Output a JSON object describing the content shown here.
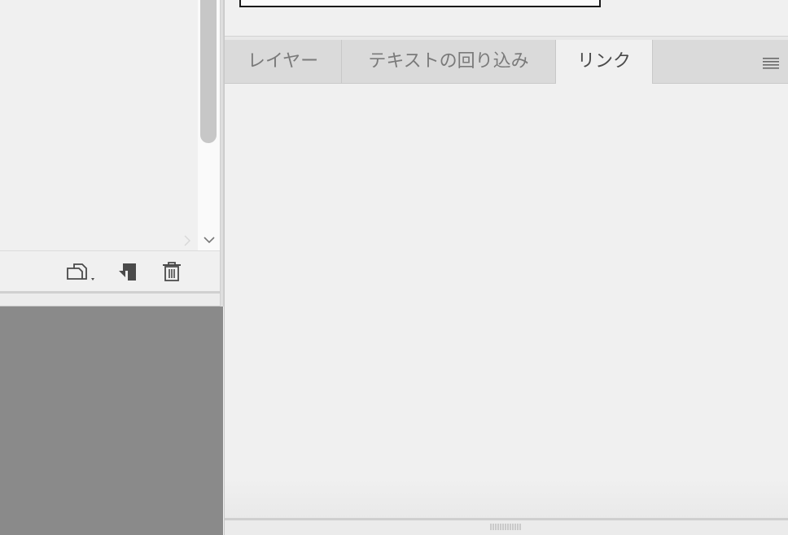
{
  "tabs": [
    {
      "label": "レイヤー"
    },
    {
      "label": "テキストの回り込み"
    },
    {
      "label": "リンク"
    }
  ],
  "active_tab": "リンク",
  "icons": {
    "tab_menu": "hamburger-icon",
    "toolbar": [
      "new-page-icon",
      "duplicate-icon",
      "trash-icon"
    ],
    "scroll_down": "chevron-down-icon",
    "scroll_right": "chevron-right-icon"
  },
  "colors": {
    "panel_bg": "#f0f0f0",
    "tab_bar_bg": "#dadada",
    "canvas_gray": "#8a8a8a",
    "icon_dark": "#4a4a4a"
  }
}
